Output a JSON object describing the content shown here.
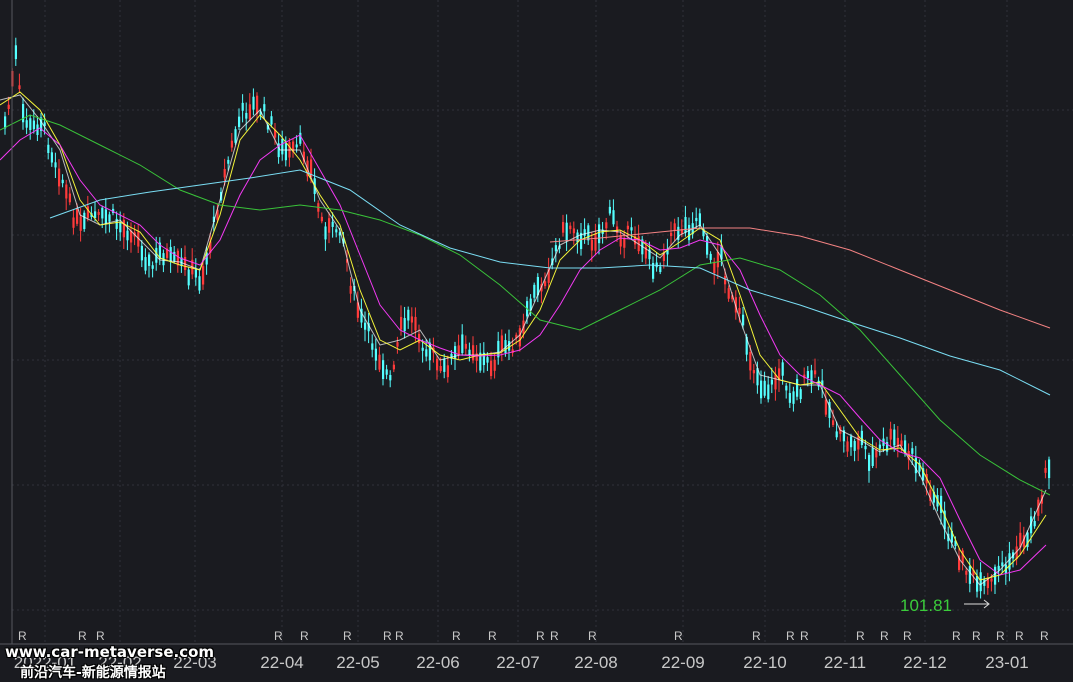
{
  "chart_data": {
    "type": "candlestick",
    "x_ticks": [
      "2022-01",
      "22-02",
      "22-03",
      "22-04",
      "22-05",
      "22-06",
      "22-07",
      "22-08",
      "22-09",
      "22-10",
      "22-11",
      "22-12",
      "23-01"
    ],
    "grid": true,
    "low_annotation": "101.81",
    "marker_text": "R",
    "price_proxy_series": [
      "MA5",
      "MA10",
      "MA20",
      "MA60",
      "MA120",
      "MA250"
    ],
    "colors": {
      "background": "#1a1b20",
      "up": "#ff3b3b",
      "down": "#54ffff",
      "ma5": "#ffffff",
      "ma10": "#ffff3b",
      "ma20": "#ff3bff",
      "ma60": "#3bcc3b",
      "ma120": "#7fe8ff",
      "ma250": "#ff8888",
      "annotation": "#3bcc3b",
      "axis_text": "#c8c8c8",
      "grid": "#30323a"
    },
    "path_points": [
      [
        0,
        140
      ],
      [
        8,
        105
      ],
      [
        15,
        55
      ],
      [
        20,
        110
      ],
      [
        30,
        130
      ],
      [
        40,
        120
      ],
      [
        50,
        150
      ],
      [
        60,
        175
      ],
      [
        70,
        210
      ],
      [
        80,
        230
      ],
      [
        90,
        215
      ],
      [
        100,
        220
      ],
      [
        110,
        215
      ],
      [
        120,
        228
      ],
      [
        130,
        230
      ],
      [
        140,
        245
      ],
      [
        150,
        270
      ],
      [
        160,
        250
      ],
      [
        170,
        262
      ],
      [
        180,
        265
      ],
      [
        190,
        272
      ],
      [
        200,
        280
      ],
      [
        210,
        240
      ],
      [
        220,
        190
      ],
      [
        230,
        150
      ],
      [
        240,
        115
      ],
      [
        250,
        105
      ],
      [
        260,
        110
      ],
      [
        270,
        125
      ],
      [
        280,
        150
      ],
      [
        290,
        155
      ],
      [
        300,
        145
      ],
      [
        310,
        170
      ],
      [
        320,
        220
      ],
      [
        330,
        232
      ],
      [
        340,
        225
      ],
      [
        350,
        285
      ],
      [
        360,
        320
      ],
      [
        370,
        340
      ],
      [
        380,
        360
      ],
      [
        390,
        385
      ],
      [
        400,
        330
      ],
      [
        410,
        315
      ],
      [
        420,
        340
      ],
      [
        430,
        350
      ],
      [
        440,
        375
      ],
      [
        450,
        360
      ],
      [
        460,
        350
      ],
      [
        470,
        345
      ],
      [
        480,
        360
      ],
      [
        490,
        365
      ],
      [
        500,
        350
      ],
      [
        510,
        345
      ],
      [
        520,
        340
      ],
      [
        530,
        300
      ],
      [
        540,
        285
      ],
      [
        550,
        265
      ],
      [
        560,
        235
      ],
      [
        570,
        225
      ],
      [
        580,
        235
      ],
      [
        590,
        240
      ],
      [
        600,
        232
      ],
      [
        610,
        215
      ],
      [
        620,
        235
      ],
      [
        630,
        235
      ],
      [
        640,
        240
      ],
      [
        650,
        265
      ],
      [
        660,
        262
      ],
      [
        670,
        235
      ],
      [
        680,
        228
      ],
      [
        690,
        225
      ],
      [
        700,
        215
      ],
      [
        710,
        265
      ],
      [
        720,
        255
      ],
      [
        730,
        300
      ],
      [
        740,
        320
      ],
      [
        750,
        360
      ],
      [
        760,
        385
      ],
      [
        770,
        388
      ],
      [
        780,
        370
      ],
      [
        790,
        395
      ],
      [
        800,
        388
      ],
      [
        810,
        375
      ],
      [
        820,
        385
      ],
      [
        830,
        415
      ],
      [
        840,
        440
      ],
      [
        850,
        445
      ],
      [
        860,
        438
      ],
      [
        870,
        462
      ],
      [
        880,
        448
      ],
      [
        890,
        440
      ],
      [
        900,
        445
      ],
      [
        910,
        455
      ],
      [
        920,
        470
      ],
      [
        930,
        490
      ],
      [
        940,
        510
      ],
      [
        950,
        540
      ],
      [
        960,
        560
      ],
      [
        970,
        575
      ],
      [
        980,
        590
      ],
      [
        990,
        585
      ],
      [
        1000,
        568
      ],
      [
        1010,
        560
      ],
      [
        1020,
        545
      ],
      [
        1030,
        530
      ],
      [
        1040,
        500
      ],
      [
        1046,
        465
      ]
    ],
    "ma_paths": {
      "ma5": [
        [
          0,
          100
        ],
        [
          20,
          95
        ],
        [
          40,
          120
        ],
        [
          60,
          150
        ],
        [
          80,
          215
        ],
        [
          100,
          225
        ],
        [
          120,
          220
        ],
        [
          140,
          240
        ],
        [
          160,
          260
        ],
        [
          180,
          262
        ],
        [
          200,
          270
        ],
        [
          220,
          200
        ],
        [
          240,
          130
        ],
        [
          260,
          110
        ],
        [
          280,
          150
        ],
        [
          300,
          150
        ],
        [
          320,
          200
        ],
        [
          340,
          230
        ],
        [
          360,
          310
        ],
        [
          380,
          345
        ],
        [
          400,
          340
        ],
        [
          420,
          330
        ],
        [
          440,
          360
        ],
        [
          460,
          355
        ],
        [
          480,
          355
        ],
        [
          500,
          352
        ],
        [
          520,
          335
        ],
        [
          540,
          290
        ],
        [
          560,
          245
        ],
        [
          580,
          235
        ],
        [
          600,
          230
        ],
        [
          620,
          232
        ],
        [
          640,
          245
        ],
        [
          660,
          258
        ],
        [
          680,
          235
        ],
        [
          700,
          225
        ],
        [
          720,
          255
        ],
        [
          740,
          320
        ],
        [
          760,
          375
        ],
        [
          780,
          380
        ],
        [
          800,
          385
        ],
        [
          820,
          385
        ],
        [
          840,
          430
        ],
        [
          860,
          440
        ],
        [
          880,
          452
        ],
        [
          900,
          445
        ],
        [
          920,
          475
        ],
        [
          940,
          520
        ],
        [
          960,
          560
        ],
        [
          980,
          585
        ],
        [
          1000,
          570
        ],
        [
          1020,
          548
        ],
        [
          1046,
          490
        ]
      ],
      "ma10": [
        [
          0,
          105
        ],
        [
          20,
          92
        ],
        [
          40,
          110
        ],
        [
          60,
          145
        ],
        [
          80,
          200
        ],
        [
          100,
          225
        ],
        [
          120,
          222
        ],
        [
          140,
          232
        ],
        [
          160,
          258
        ],
        [
          180,
          265
        ],
        [
          200,
          270
        ],
        [
          220,
          215
        ],
        [
          240,
          140
        ],
        [
          260,
          115
        ],
        [
          280,
          135
        ],
        [
          300,
          160
        ],
        [
          320,
          195
        ],
        [
          340,
          225
        ],
        [
          360,
          290
        ],
        [
          380,
          340
        ],
        [
          400,
          350
        ],
        [
          420,
          340
        ],
        [
          440,
          355
        ],
        [
          460,
          360
        ],
        [
          480,
          355
        ],
        [
          500,
          353
        ],
        [
          520,
          340
        ],
        [
          540,
          310
        ],
        [
          560,
          260
        ],
        [
          580,
          240
        ],
        [
          600,
          232
        ],
        [
          620,
          230
        ],
        [
          640,
          240
        ],
        [
          660,
          255
        ],
        [
          680,
          242
        ],
        [
          700,
          228
        ],
        [
          720,
          240
        ],
        [
          740,
          295
        ],
        [
          760,
          355
        ],
        [
          780,
          380
        ],
        [
          800,
          385
        ],
        [
          820,
          382
        ],
        [
          840,
          410
        ],
        [
          860,
          438
        ],
        [
          880,
          450
        ],
        [
          900,
          448
        ],
        [
          920,
          465
        ],
        [
          940,
          505
        ],
        [
          960,
          550
        ],
        [
          980,
          580
        ],
        [
          1000,
          575
        ],
        [
          1020,
          555
        ],
        [
          1046,
          515
        ]
      ],
      "ma20": [
        [
          0,
          160
        ],
        [
          20,
          140
        ],
        [
          40,
          128
        ],
        [
          60,
          145
        ],
        [
          80,
          180
        ],
        [
          100,
          205
        ],
        [
          120,
          215
        ],
        [
          140,
          225
        ],
        [
          160,
          245
        ],
        [
          180,
          258
        ],
        [
          200,
          265
        ],
        [
          220,
          240
        ],
        [
          240,
          195
        ],
        [
          260,
          160
        ],
        [
          280,
          145
        ],
        [
          300,
          135
        ],
        [
          320,
          170
        ],
        [
          340,
          205
        ],
        [
          360,
          255
        ],
        [
          380,
          305
        ],
        [
          400,
          330
        ],
        [
          420,
          340
        ],
        [
          440,
          348
        ],
        [
          460,
          355
        ],
        [
          480,
          356
        ],
        [
          500,
          355
        ],
        [
          520,
          350
        ],
        [
          540,
          335
        ],
        [
          560,
          305
        ],
        [
          580,
          270
        ],
        [
          600,
          250
        ],
        [
          620,
          238
        ],
        [
          640,
          240
        ],
        [
          660,
          250
        ],
        [
          680,
          248
        ],
        [
          700,
          240
        ],
        [
          720,
          245
        ],
        [
          740,
          270
        ],
        [
          760,
          315
        ],
        [
          780,
          355
        ],
        [
          800,
          375
        ],
        [
          820,
          385
        ],
        [
          840,
          395
        ],
        [
          860,
          418
        ],
        [
          880,
          440
        ],
        [
          900,
          452
        ],
        [
          920,
          458
        ],
        [
          940,
          478
        ],
        [
          960,
          520
        ],
        [
          980,
          560
        ],
        [
          1000,
          575
        ],
        [
          1020,
          570
        ],
        [
          1046,
          545
        ]
      ],
      "ma60": [
        [
          0,
          130
        ],
        [
          30,
          115
        ],
        [
          60,
          125
        ],
        [
          100,
          145
        ],
        [
          140,
          165
        ],
        [
          180,
          190
        ],
        [
          220,
          205
        ],
        [
          260,
          210
        ],
        [
          300,
          205
        ],
        [
          340,
          210
        ],
        [
          380,
          220
        ],
        [
          420,
          235
        ],
        [
          460,
          255
        ],
        [
          500,
          285
        ],
        [
          540,
          320
        ],
        [
          580,
          330
        ],
        [
          620,
          310
        ],
        [
          660,
          290
        ],
        [
          700,
          265
        ],
        [
          740,
          258
        ],
        [
          780,
          270
        ],
        [
          820,
          295
        ],
        [
          860,
          330
        ],
        [
          900,
          375
        ],
        [
          940,
          420
        ],
        [
          980,
          455
        ],
        [
          1020,
          480
        ],
        [
          1050,
          495
        ]
      ],
      "ma120": [
        [
          50,
          218
        ],
        [
          100,
          200
        ],
        [
          150,
          192
        ],
        [
          200,
          185
        ],
        [
          250,
          178
        ],
        [
          300,
          170
        ],
        [
          350,
          190
        ],
        [
          400,
          225
        ],
        [
          450,
          248
        ],
        [
          500,
          262
        ],
        [
          550,
          268
        ],
        [
          600,
          268
        ],
        [
          650,
          265
        ],
        [
          700,
          268
        ],
        [
          750,
          290
        ],
        [
          800,
          305
        ],
        [
          850,
          322
        ],
        [
          900,
          338
        ],
        [
          950,
          356
        ],
        [
          1000,
          370
        ],
        [
          1050,
          395
        ]
      ],
      "ma250": [
        [
          550,
          242
        ],
        [
          600,
          238
        ],
        [
          650,
          233
        ],
        [
          700,
          228
        ],
        [
          750,
          228
        ],
        [
          800,
          236
        ],
        [
          850,
          250
        ],
        [
          900,
          270
        ],
        [
          950,
          290
        ],
        [
          1000,
          310
        ],
        [
          1050,
          328
        ]
      ]
    },
    "r_marker_x": [
      18,
      78,
      96,
      274,
      300,
      343,
      383,
      395,
      452,
      488,
      536,
      550,
      588,
      674,
      752,
      786,
      800,
      856,
      880,
      903,
      952,
      972,
      996,
      1015,
      1040
    ]
  },
  "watermark": {
    "url": "www.car-metaverse.com",
    "name": "前沿汽车-新能源情报站"
  }
}
